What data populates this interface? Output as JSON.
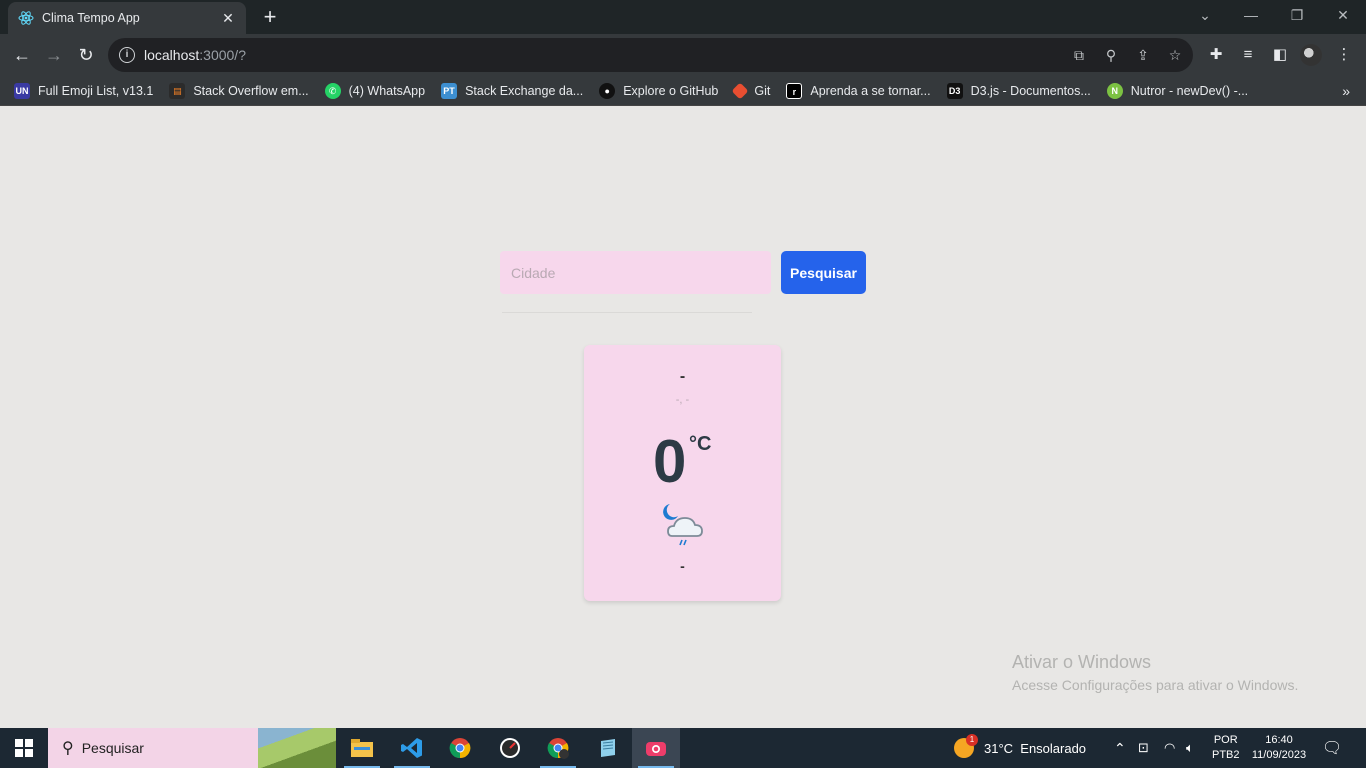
{
  "browser": {
    "tab_title": "Clima Tempo App",
    "tab_close": "✕",
    "new_tab": "+",
    "url_host": "localhost",
    "url_rest": ":3000/?",
    "bookmarks": [
      {
        "label": "Full Emoji List, v13.1",
        "icon": "UN",
        "color": "#3a3aa3"
      },
      {
        "label": "Stack Overflow em...",
        "icon": "SO",
        "color": "#2b2b2b"
      },
      {
        "label": "(4) WhatsApp",
        "icon": "W",
        "color": "#25d366"
      },
      {
        "label": "Stack Exchange da...",
        "icon": "PT",
        "color": "#3d8fd1"
      },
      {
        "label": "Explore o GitHub",
        "icon": "GH",
        "color": "#111111"
      },
      {
        "label": "Git",
        "icon": "G",
        "color": "#e84e31"
      },
      {
        "label": "Aprenda a se tornar...",
        "icon": "r",
        "color": "#000000"
      },
      {
        "label": "D3.js - Documentos...",
        "icon": "D3",
        "color": "#111111"
      },
      {
        "label": "Nutror - newDev() -...",
        "icon": "N",
        "color": "#7cc242"
      }
    ],
    "more_bookmarks": "»"
  },
  "app": {
    "search_placeholder": "Cidade",
    "search_button": "Pesquisar",
    "city": "-",
    "coords": "-, -",
    "temperature": "0",
    "unit": "°C",
    "description": "-"
  },
  "watermark": {
    "line1": "Ativar o Windows",
    "line2": "Acesse Configurações para ativar o Windows."
  },
  "taskbar": {
    "search_label": "Pesquisar",
    "weather": "31°C  Ensolarado",
    "lang_top": "POR",
    "lang_bottom": "PTB2",
    "time": "16:40",
    "date": "11/09/2023",
    "badge": "1"
  }
}
